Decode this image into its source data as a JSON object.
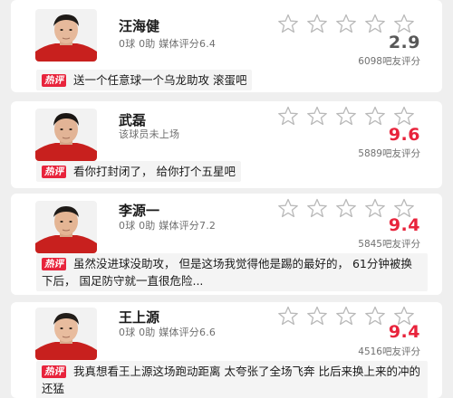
{
  "hot_tag": "热评",
  "players": [
    {
      "name": "汪海健",
      "stats": "0球 0助  媒体评分6.4",
      "score": "2.9",
      "score_color": "#585858",
      "fan_count": "6098吧友评分",
      "comment": "送一个任意球一个乌龙助攻 滚蛋吧"
    },
    {
      "name": "武磊",
      "stats": "该球员未上场",
      "score": "9.6",
      "score_color": "#e8243c",
      "fan_count": "5889吧友评分",
      "comment": "看你打封闭了， 给你打个五星吧"
    },
    {
      "name": "李源一",
      "stats": "0球 0助  媒体评分7.2",
      "score": "9.4",
      "score_color": "#e8243c",
      "fan_count": "5845吧友评分",
      "comment": "虽然没进球没助攻， 但是这场我觉得他是踢的最好的， 61分钟被换下后， 国足防守就一直很危险..."
    },
    {
      "name": "王上源",
      "stats": "0球 0助  媒体评分6.6",
      "score": "9.4",
      "score_color": "#e8243c",
      "fan_count": "4516吧友评分",
      "comment": "我真想看王上源这场跑动距离 太夸张了全场飞奔 比后来换上来的冲的还猛"
    }
  ],
  "star_icon": "star-outline-icon",
  "star_count": 5
}
